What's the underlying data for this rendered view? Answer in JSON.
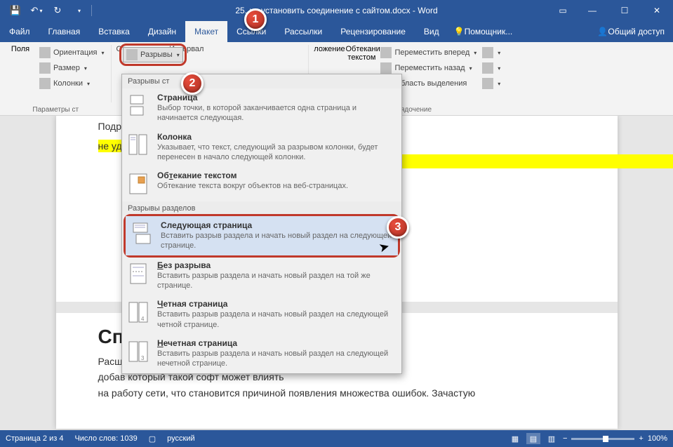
{
  "title": "25. не            установить соединение с сайтом.docx - Word",
  "tabs": {
    "file": "Файл",
    "home": "Главная",
    "insert": "Вставка",
    "design": "Дизайн",
    "layout": "Макет",
    "references": "Ссылки",
    "mailings": "Рассылки",
    "review": "Рецензирование",
    "view": "Вид",
    "tell": "Помощник...",
    "share": "Общий доступ"
  },
  "ribbon": {
    "margins": "Поля",
    "orientation": "Ориентация",
    "size": "Размер",
    "columns": "Колонки",
    "breaks": "Разрывы",
    "indent": "Отступ",
    "spacing": "Интервал",
    "params": "Параметры ст",
    "position": "ложение",
    "wrap": "Обтекание текстом",
    "forward": "Переместить вперед",
    "backward": "Переместить назад",
    "selection": "Область выделения",
    "arrange": "Упорядочение"
  },
  "menu": {
    "sec1": "Разрывы ст",
    "page": {
      "t": "Страница",
      "d": "Выбор точки, в которой заканчивается одна страница и начинается следующая."
    },
    "column": {
      "t": "Колонка",
      "d": "Указывает, что текст, следующий за разрывом колонки, будет перенесен в начало следующей колонки."
    },
    "textwrap": {
      "t": "Обтекание текстом",
      "u": "т",
      "d": "Обтекание текста вокруг объектов на веб-страницах."
    },
    "sec2": "Разрывы разделов",
    "nextpage": {
      "t": "Следующая страница",
      "d": "Вставить разрыв раздела и начать новый раздел на следующей странице."
    },
    "continuous": {
      "t": "Без разрыва",
      "u": "Б",
      "d": "Вставить разрыв раздела и начать новый раздел на той же странице."
    },
    "even": {
      "t": "Четная страница",
      "u": "Ч",
      "d": "Вставить разрыв раздела и начать новый раздел на следующей четной странице."
    },
    "odd": {
      "t": "Нечетная страница",
      "u": "Н",
      "d": "Вставить разрыв раздела и начать новый раздел на следующей нечетной странице."
    }
  },
  "doc": {
    "l1": "Подро",
    "l2": "не уда",
    "h1": "Спо                                                                ний",
    "p1": "Расши                                                                                                                       имное обеспечение, которое",
    "p2": "добав                                                                                                                       который такой софт может влиять",
    "p3": "на работу сети, что становится причиной появления множества ошибок. Зачастую"
  },
  "status": {
    "page": "Страница 2 из 4",
    "words": "Число слов: 1039",
    "lang": "русский",
    "zoom": "100%"
  }
}
